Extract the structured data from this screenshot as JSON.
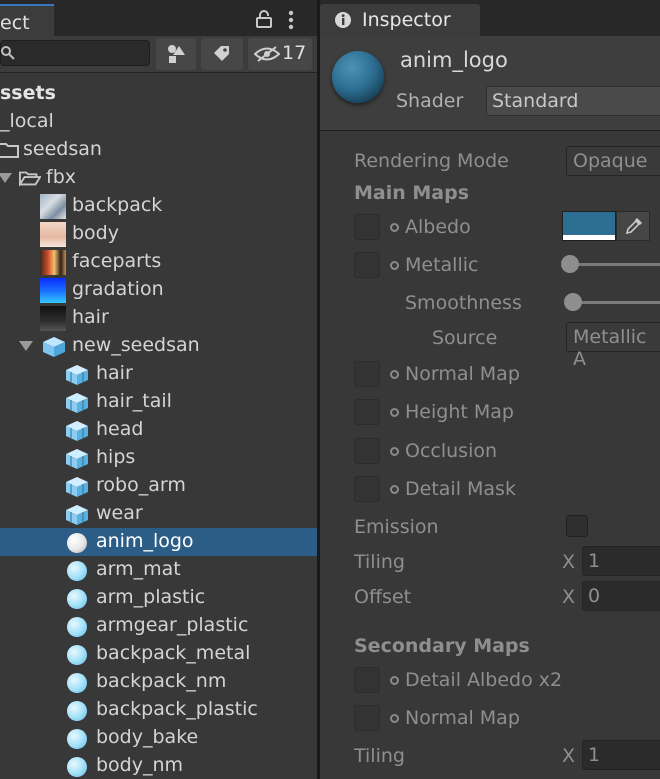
{
  "project": {
    "tab_label": "ect",
    "search_placeholder": "",
    "hidden_count": "17",
    "tree": [
      {
        "label": "ssets",
        "kind": "header"
      },
      {
        "label": "_local",
        "kind": "folder"
      },
      {
        "label": "seedsan",
        "kind": "folder"
      },
      {
        "label": "fbx",
        "kind": "folder"
      },
      {
        "label": "backpack",
        "kind": "texture"
      },
      {
        "label": "body",
        "kind": "texture"
      },
      {
        "label": "faceparts",
        "kind": "texture"
      },
      {
        "label": "gradation",
        "kind": "texture"
      },
      {
        "label": "hair",
        "kind": "texture"
      },
      {
        "label": "new_seedsan",
        "kind": "prefab"
      },
      {
        "label": "hair",
        "kind": "mesh"
      },
      {
        "label": "hair_tail",
        "kind": "mesh"
      },
      {
        "label": "head",
        "kind": "mesh"
      },
      {
        "label": "hips",
        "kind": "mesh"
      },
      {
        "label": "robo_arm",
        "kind": "mesh"
      },
      {
        "label": "wear",
        "kind": "mesh"
      },
      {
        "label": "anim_logo",
        "kind": "material",
        "selected": true
      },
      {
        "label": "arm_mat",
        "kind": "material"
      },
      {
        "label": "arm_plastic",
        "kind": "material"
      },
      {
        "label": "armgear_plastic",
        "kind": "material"
      },
      {
        "label": "backpack_metal",
        "kind": "material"
      },
      {
        "label": "backpack_nm",
        "kind": "material"
      },
      {
        "label": "backpack_plastic",
        "kind": "material"
      },
      {
        "label": "body_bake",
        "kind": "material"
      },
      {
        "label": "body_nm",
        "kind": "material"
      }
    ]
  },
  "inspector": {
    "tab_label": "Inspector",
    "material_name": "anim_logo",
    "shader_label": "Shader",
    "shader_value": "Standard",
    "rendering_mode_label": "Rendering Mode",
    "rendering_mode_value": "Opaque",
    "main_maps_label": "Main Maps",
    "albedo_label": "Albedo",
    "albedo_color": "#2d6f93",
    "metallic_label": "Metallic",
    "smoothness_label": "Smoothness",
    "source_label": "Source",
    "source_value": "Metallic A",
    "normal_map_label": "Normal Map",
    "height_map_label": "Height Map",
    "occlusion_label": "Occlusion",
    "detail_mask_label": "Detail Mask",
    "emission_label": "Emission",
    "tiling_label": "Tiling",
    "tiling_x_label": "X",
    "tiling_x_value": "1",
    "offset_label": "Offset",
    "offset_x_label": "X",
    "offset_x_value": "0",
    "secondary_maps_label": "Secondary Maps",
    "detail_albedo_label": "Detail Albedo x2",
    "normal_map2_label": "Normal Map",
    "tiling2_label": "Tiling",
    "tiling2_x_label": "X",
    "tiling2_x_value": "1"
  },
  "colors": {
    "selection": "#2c5d87",
    "accent": "#3a79bb"
  }
}
